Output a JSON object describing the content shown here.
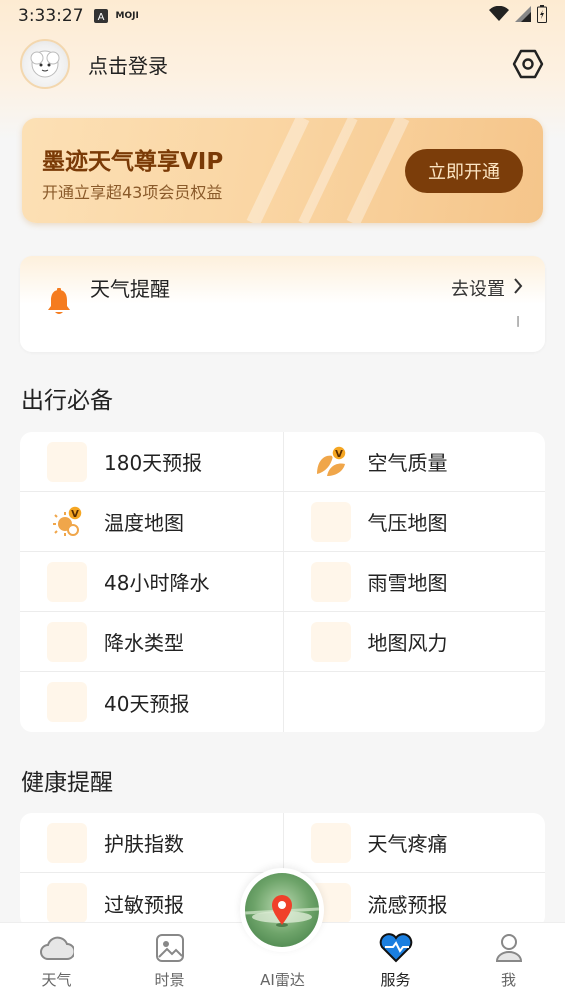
{
  "status_bar": {
    "time": "3:33:27",
    "app_badge": "A",
    "moji_label": "MOJI",
    "icons": [
      "a-badge-icon",
      "moji-icon",
      "wifi-icon",
      "signal-icon",
      "battery-icon"
    ]
  },
  "header": {
    "login_text": "点击登录",
    "icons": [
      "avatar",
      "settings-hex-icon"
    ]
  },
  "vip": {
    "title": "墨迹天气尊享VIP",
    "subtitle": "开通立享超43项会员权益",
    "button": "立即开通",
    "colors": {
      "button_bg": "#7b3d0a",
      "title": "#7a3a06"
    }
  },
  "reminder": {
    "title": "天气提醒",
    "link": "去设置",
    "mark": "㆐",
    "icons": [
      "bell-icon",
      "chevron-right-icon"
    ],
    "colors": {
      "bell": "#f57c1f"
    }
  },
  "travel": {
    "title": "出行必备",
    "items": [
      {
        "label": "180天预报",
        "icon": "placeholder-icon"
      },
      {
        "label": "空气质量",
        "icon": "leaf-vip-icon"
      },
      {
        "label": "温度地图",
        "icon": "temperature-vip-icon"
      },
      {
        "label": "气压地图",
        "icon": "placeholder-icon"
      },
      {
        "label": "48小时降水",
        "icon": "placeholder-icon"
      },
      {
        "label": "雨雪地图",
        "icon": "placeholder-icon"
      },
      {
        "label": "降水类型",
        "icon": "placeholder-icon"
      },
      {
        "label": "地图风力",
        "icon": "placeholder-icon"
      },
      {
        "label": "40天预报",
        "icon": "placeholder-icon"
      }
    ]
  },
  "health": {
    "title": "健康提醒",
    "items": [
      {
        "label": "护肤指数",
        "icon": "placeholder-icon"
      },
      {
        "label": "天气疼痛",
        "icon": "placeholder-icon"
      },
      {
        "label": "过敏预报",
        "icon": "placeholder-icon"
      },
      {
        "label": "流感预报",
        "icon": "placeholder-icon"
      }
    ]
  },
  "nav": {
    "items": [
      {
        "label": "天气",
        "icon": "cloud-icon"
      },
      {
        "label": "时景",
        "icon": "picture-icon"
      },
      {
        "label": "AI雷达",
        "icon": "radar-location-icon"
      },
      {
        "label": "服务",
        "icon": "service-heart-icon",
        "active": true
      },
      {
        "label": "我",
        "icon": "user-icon"
      }
    ],
    "colors": {
      "active": "#1b7fe0"
    }
  }
}
